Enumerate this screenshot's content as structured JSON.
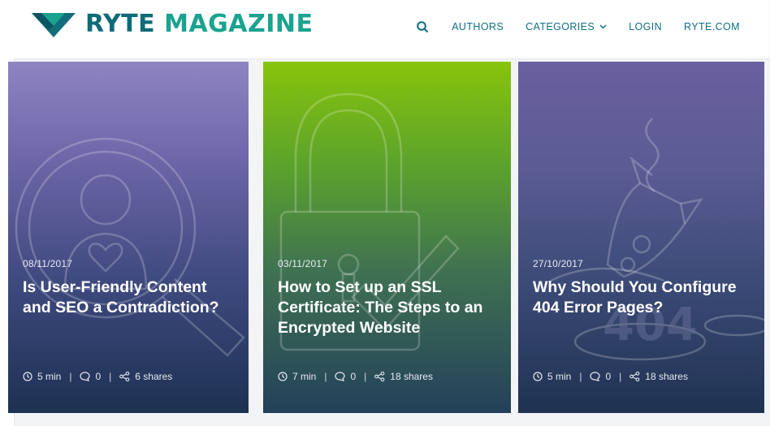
{
  "brand": {
    "name_part1": "RYTE",
    "name_part2": "MAGAZINE",
    "colors": {
      "dark_teal": "#0f6b78",
      "teal": "#1aa38f",
      "nav": "#0e6e84"
    }
  },
  "nav": {
    "search_icon": "search-icon",
    "items": [
      {
        "label": "AUTHORS"
      },
      {
        "label": "CATEGORIES",
        "has_dropdown": true
      },
      {
        "label": "LOGIN"
      },
      {
        "label": "RYTE.COM"
      }
    ]
  },
  "articles": [
    {
      "date": "08/11/2017",
      "title": "Is User-Friendly Content and SEO a Contradiction?",
      "read_time": "5 min",
      "comments": "0",
      "shares": "6 shares",
      "illustration": "magnifier-user-heart",
      "colors": [
        "#8e84c2",
        "#1d3152"
      ]
    },
    {
      "date": "03/11/2017",
      "title": "How to Set up an SSL Certificate: The Steps to an Encrypted Website",
      "read_time": "7 min",
      "comments": "0",
      "shares": "18 shares",
      "illustration": "padlock-check",
      "colors": [
        "#88c40c",
        "#23405a"
      ]
    },
    {
      "date": "27/10/2017",
      "title": "Why Should You Configure 404 Error Pages?",
      "read_time": "5 min",
      "comments": "0",
      "shares": "18 shares",
      "illustration": "crashed-rocket-404",
      "illustration_text": "404",
      "colors": [
        "#6a5f9f",
        "#1f3251"
      ]
    }
  ],
  "meta_separator": "|"
}
